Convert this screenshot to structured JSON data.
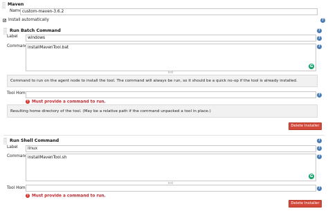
{
  "maven": {
    "title": "Maven",
    "name_label": "Name",
    "name_value": "custom-maven-3.6.2",
    "install_auto_label": "Install automatically",
    "install_auto_checked": "✔"
  },
  "batch": {
    "title": "Run Batch Command",
    "label_label": "Label",
    "label_value": "windows",
    "command_label": "Command",
    "command_value": "installMavenTool.bat",
    "command_help": "Command to run on the agent node to install the tool. The command will always be run, so it should be a quick no-op if the tool is already installed.",
    "tool_home_label": "Tool Home",
    "tool_home_value": "",
    "error": "Must provide a command to run.",
    "tool_home_help": "Resulting home directory of the tool. (May be a relative path if the command unpacked a tool in place.)",
    "delete_label": "Delete Installer"
  },
  "shell": {
    "title": "Run Shell Command",
    "label_label": "Label",
    "label_value": "linux",
    "command_label": "Command",
    "command_value": "installMavenTool.sh",
    "tool_home_label": "Tool Home",
    "tool_home_value": "",
    "error": "Must provide a command to run.",
    "delete_label": "Delete Installer"
  },
  "icons": {
    "help_glyph": "?",
    "error_glyph": "!",
    "grammarly_glyph": "G"
  }
}
